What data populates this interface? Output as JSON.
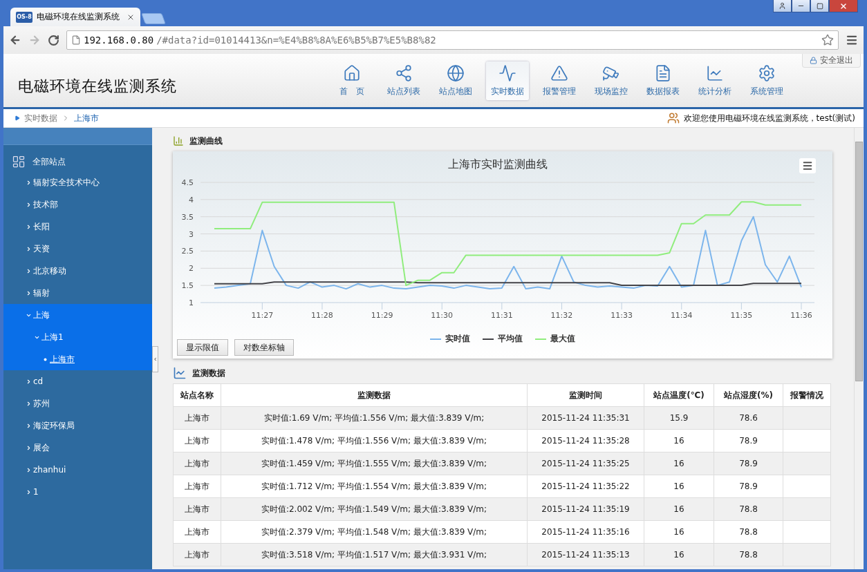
{
  "browser": {
    "favicon_text": "OS-8",
    "tabs": [
      {
        "title": "电磁环境在线监测系统",
        "selected": true
      }
    ],
    "url_host": "192.168.0.80",
    "url_path": "/#data?id=01014413&n=%E4%B8%8A%E6%B5%B7%E5%B8%82"
  },
  "header": {
    "logo": "电磁环境在线监测系统",
    "logout": "安全退出",
    "nav": [
      {
        "label": "首　页",
        "selected": false
      },
      {
        "label": "站点列表",
        "selected": false
      },
      {
        "label": "站点地图",
        "selected": false
      },
      {
        "label": "实时数据",
        "selected": true
      },
      {
        "label": "报警管理",
        "selected": false
      },
      {
        "label": "现场监控",
        "selected": false
      },
      {
        "label": "数据报表",
        "selected": false
      },
      {
        "label": "统计分析",
        "selected": false
      },
      {
        "label": "系统管理",
        "selected": false
      }
    ]
  },
  "breadcrumb": [
    "实时数据",
    "上海市"
  ],
  "welcome": "欢迎您使用电磁环境在线监测系统，test(测试)",
  "sidebar": {
    "root": "全部站点",
    "items": [
      {
        "label": "辐射安全技术中心",
        "expanded": false
      },
      {
        "label": "技术部",
        "expanded": false
      },
      {
        "label": "长阳",
        "expanded": false
      },
      {
        "label": "天资",
        "expanded": false
      },
      {
        "label": "北京移动",
        "expanded": false
      },
      {
        "label": "辐射",
        "expanded": false
      },
      {
        "label": "上海",
        "expanded": true,
        "children": [
          {
            "label": "上海1",
            "expanded": true,
            "children": [
              {
                "label": "上海市",
                "selected": true
              }
            ]
          }
        ]
      },
      {
        "label": "cd",
        "expanded": false
      },
      {
        "label": "苏州",
        "expanded": false
      },
      {
        "label": "海淀环保局",
        "expanded": false
      },
      {
        "label": "展会",
        "expanded": false
      },
      {
        "label": "zhanhui",
        "expanded": false
      },
      {
        "label": "1",
        "expanded": false
      }
    ]
  },
  "curve_section": {
    "title": "监测曲线",
    "chart_data": {
      "type": "line",
      "title": "上海市实时监测曲线",
      "categories": [
        null,
        null,
        null,
        null,
        "11:27",
        null,
        null,
        null,
        null,
        "11:28",
        null,
        null,
        null,
        null,
        "11:29",
        null,
        null,
        null,
        null,
        "11:30",
        null,
        null,
        null,
        null,
        "11:31",
        null,
        null,
        null,
        null,
        "11:32",
        null,
        null,
        null,
        null,
        "11:33",
        null,
        null,
        null,
        null,
        "11:34",
        null,
        null,
        null,
        null,
        "11:35",
        null,
        null,
        null,
        null,
        "11:36"
      ],
      "series": [
        {
          "name": "实时值",
          "color": "#7cb5ec",
          "values": [
            1.42,
            1.45,
            1.5,
            1.55,
            3.1,
            2.05,
            1.5,
            1.42,
            1.6,
            1.45,
            1.5,
            1.4,
            1.55,
            1.45,
            1.5,
            1.42,
            1.4,
            1.45,
            1.5,
            1.48,
            1.42,
            1.5,
            1.45,
            1.4,
            1.42,
            2.05,
            1.4,
            1.45,
            1.4,
            2.35,
            1.6,
            1.5,
            1.45,
            1.48,
            1.45,
            1.42,
            1.5,
            1.48,
            2.05,
            1.45,
            1.5,
            3.1,
            1.5,
            1.6,
            2.8,
            3.5,
            2.1,
            1.6,
            2.35,
            1.45
          ]
        },
        {
          "name": "平均值",
          "color": "#434348",
          "values": [
            1.55,
            1.55,
            1.55,
            1.55,
            1.55,
            1.6,
            1.6,
            1.6,
            1.6,
            1.6,
            1.6,
            1.6,
            1.6,
            1.6,
            1.6,
            1.6,
            1.6,
            1.58,
            1.58,
            1.58,
            1.58,
            1.58,
            1.58,
            1.58,
            1.58,
            1.58,
            1.58,
            1.58,
            1.58,
            1.58,
            1.58,
            1.58,
            1.58,
            1.58,
            1.5,
            1.5,
            1.5,
            1.5,
            1.5,
            1.5,
            1.5,
            1.5,
            1.5,
            1.5,
            1.5,
            1.56,
            1.56,
            1.56,
            1.56,
            1.56
          ]
        },
        {
          "name": "最大值",
          "color": "#90ed7d",
          "values": [
            3.15,
            3.15,
            3.15,
            3.15,
            3.92,
            3.92,
            3.92,
            3.92,
            3.92,
            3.92,
            3.92,
            3.92,
            3.92,
            3.92,
            3.92,
            3.92,
            1.5,
            1.65,
            1.65,
            1.87,
            1.87,
            2.38,
            2.38,
            2.38,
            2.38,
            2.38,
            2.38,
            2.38,
            2.38,
            2.38,
            2.38,
            2.38,
            2.38,
            2.38,
            2.38,
            2.38,
            2.38,
            2.38,
            2.45,
            3.3,
            3.3,
            3.55,
            3.55,
            3.55,
            3.93,
            3.93,
            3.84,
            3.84,
            3.84,
            3.84
          ]
        }
      ],
      "ylim": [
        1,
        4.5
      ],
      "grid": true,
      "yticks": [
        1,
        1.5,
        2,
        2.5,
        3,
        3.5,
        4,
        4.5
      ]
    },
    "buttons": [
      "显示限值",
      "对数坐标轴"
    ]
  },
  "data_section": {
    "title": "监测数据",
    "columns": [
      "站点名称",
      "监测数据",
      "监测时间",
      "站点温度(℃)",
      "站点湿度(%)",
      "报警情况"
    ],
    "rows": [
      [
        "上海市",
        "实时值:1.69 V/m; 平均值:1.556 V/m; 最大值:3.839 V/m;",
        "2015-11-24 11:35:31",
        "15.9",
        "78.6"
      ],
      [
        "上海市",
        "实时值:1.478 V/m; 平均值:1.556 V/m; 最大值:3.839 V/m;",
        "2015-11-24 11:35:28",
        "16",
        "78.9"
      ],
      [
        "上海市",
        "实时值:1.459 V/m; 平均值:1.555 V/m; 最大值:3.839 V/m;",
        "2015-11-24 11:35:25",
        "16",
        "78.9"
      ],
      [
        "上海市",
        "实时值:1.712 V/m; 平均值:1.554 V/m; 最大值:3.839 V/m;",
        "2015-11-24 11:35:22",
        "16",
        "78.9"
      ],
      [
        "上海市",
        "实时值:2.002 V/m; 平均值:1.549 V/m; 最大值:3.839 V/m;",
        "2015-11-24 11:35:19",
        "16",
        "78.8"
      ],
      [
        "上海市",
        "实时值:2.379 V/m; 平均值:1.548 V/m; 最大值:3.839 V/m;",
        "2015-11-24 11:35:16",
        "16",
        "78.8"
      ],
      [
        "上海市",
        "实时值:3.518 V/m; 平均值:1.517 V/m; 最大值:3.931 V/m;",
        "2015-11-24 11:35:13",
        "16",
        "78.8"
      ]
    ]
  }
}
